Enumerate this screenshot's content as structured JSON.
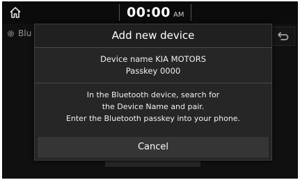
{
  "status_bar": {
    "time": "00:00",
    "ampm": "AM"
  },
  "background": {
    "settings_label": "Blu"
  },
  "dialog": {
    "title": "Add new device",
    "device_name_line": "Device name KIA MOTORS",
    "passkey_line": "Passkey 0000",
    "instructions": [
      "In the Bluetooth device, search for",
      "the Device Name and pair.",
      "Enter the Bluetooth passkey into your phone."
    ],
    "cancel_label": "Cancel"
  }
}
